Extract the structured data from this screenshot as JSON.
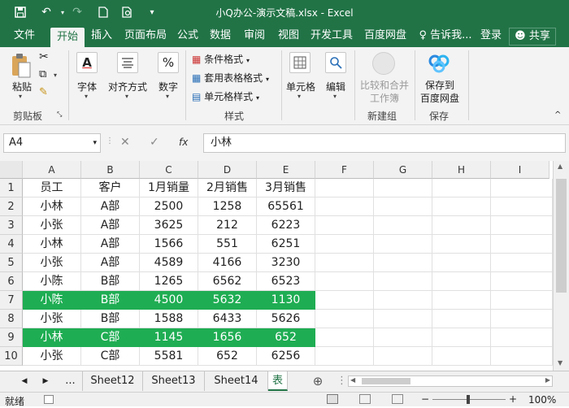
{
  "window": {
    "title": "小Q办公-演示文稿.xlsx - Excel"
  },
  "tabs": [
    {
      "label": "文件"
    },
    {
      "label": "开始"
    },
    {
      "label": "插入"
    },
    {
      "label": "页面布局"
    },
    {
      "label": "公式"
    },
    {
      "label": "数据"
    },
    {
      "label": "审阅"
    },
    {
      "label": "视图"
    },
    {
      "label": "开发工具"
    },
    {
      "label": "百度网盘"
    }
  ],
  "tellme": "告诉我...",
  "login": "登录",
  "share": "共享",
  "ribbon": {
    "paste": "粘贴",
    "clipboard": "剪贴板",
    "font": "字体",
    "align": "对齐方式",
    "number": "数字",
    "cond_format": "条件格式",
    "table_format": "套用表格格式",
    "cell_style": "单元格样式",
    "styles": "样式",
    "cells": "单元格",
    "edit": "编辑",
    "compare_1": "比较和合并",
    "compare_2": "工作簿",
    "new_group": "新建组",
    "save_1": "保存到",
    "save_2": "百度网盘",
    "save_group": "保存",
    "paste_icon_label": "A"
  },
  "formula_bar": {
    "name_box": "A4",
    "fx": "fx",
    "value": "小林"
  },
  "columns": [
    "A",
    "B",
    "C",
    "D",
    "E",
    "F",
    "G",
    "H",
    "I"
  ],
  "rows": [
    {
      "num": "1",
      "cells": [
        "员工",
        "客户",
        "1月销量",
        "2月销售",
        "3月销售"
      ],
      "hl": false
    },
    {
      "num": "2",
      "cells": [
        "小林",
        "A部",
        "2500",
        "1258",
        "65561"
      ],
      "hl": false
    },
    {
      "num": "3",
      "cells": [
        "小张",
        "A部",
        "3625",
        "212",
        "6223"
      ],
      "hl": false
    },
    {
      "num": "4",
      "cells": [
        "小林",
        "A部",
        "1566",
        "551",
        "6251"
      ],
      "hl": false
    },
    {
      "num": "5",
      "cells": [
        "小张",
        "A部",
        "4589",
        "4166",
        "3230"
      ],
      "hl": false
    },
    {
      "num": "6",
      "cells": [
        "小陈",
        "B部",
        "1265",
        "6562",
        "6523"
      ],
      "hl": false
    },
    {
      "num": "7",
      "cells": [
        "小陈",
        "B部",
        "4500",
        "5632",
        "1130"
      ],
      "hl": true
    },
    {
      "num": "8",
      "cells": [
        "小张",
        "B部",
        "1588",
        "6433",
        "5626"
      ],
      "hl": false
    },
    {
      "num": "9",
      "cells": [
        "小林",
        "C部",
        "1145",
        "1656",
        "652"
      ],
      "hl": true
    },
    {
      "num": "10",
      "cells": [
        "小张",
        "C部",
        "5581",
        "652",
        "6256"
      ],
      "hl": false
    }
  ],
  "sheets": {
    "ellipsis": "...",
    "tabs": [
      "Sheet12",
      "Sheet13",
      "Sheet14"
    ],
    "active_partial": "表"
  },
  "status": {
    "ready": "就绪",
    "zoom": "100%"
  },
  "colors": {
    "accent": "#217346",
    "highlight": "#1fad53"
  }
}
